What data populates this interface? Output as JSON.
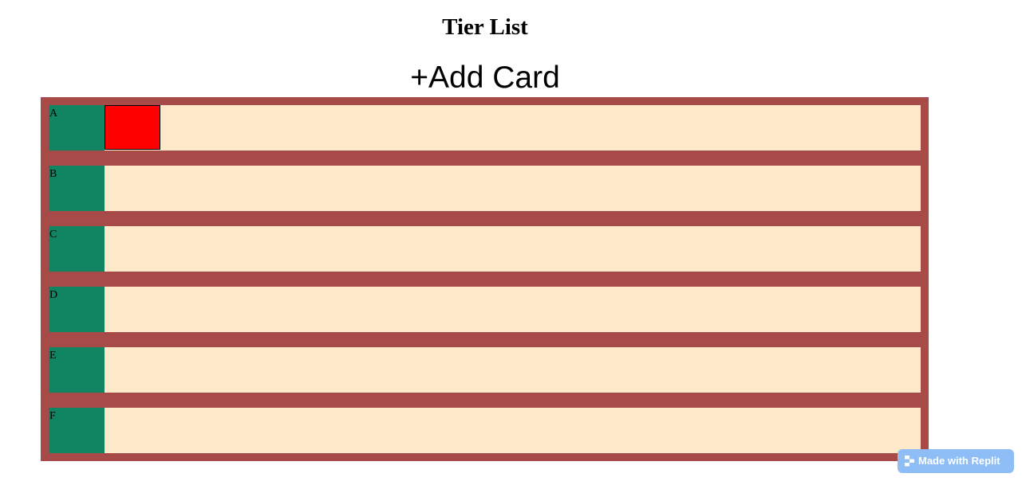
{
  "header": {
    "title": "Tier List",
    "add_card_label": "+Add Card"
  },
  "tiers": [
    {
      "label": "A",
      "cards": [
        {
          "color": "#ff0000"
        }
      ]
    },
    {
      "label": "B",
      "cards": []
    },
    {
      "label": "C",
      "cards": []
    },
    {
      "label": "D",
      "cards": []
    },
    {
      "label": "E",
      "cards": []
    },
    {
      "label": "F",
      "cards": []
    }
  ],
  "badge": {
    "label": "Made with Replit",
    "icon": "replit-icon"
  },
  "colors": {
    "board": "#a84a48",
    "tier_label": "#118462",
    "dropzone": "#feeacb",
    "badge": "#8fbdf6"
  }
}
